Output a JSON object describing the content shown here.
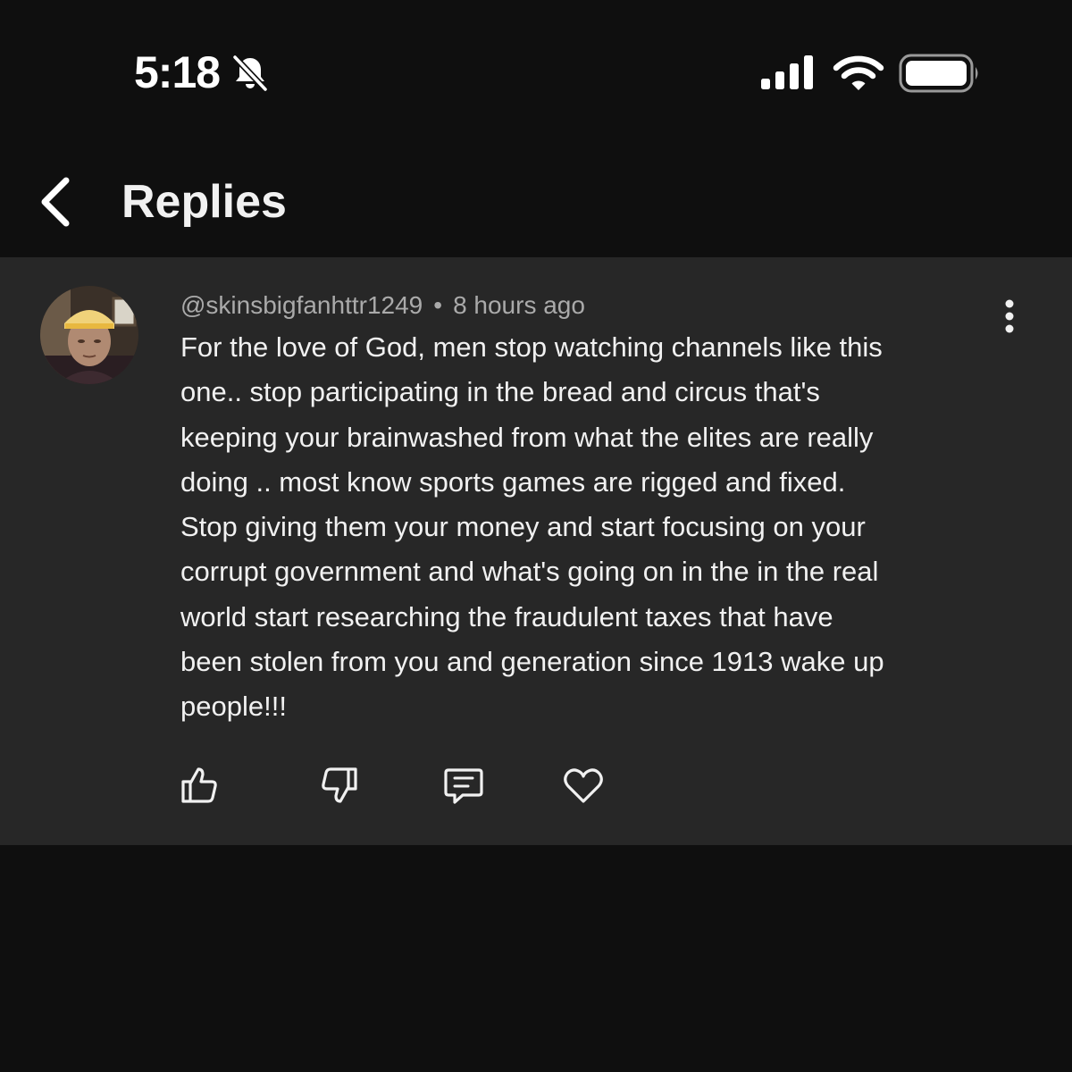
{
  "status_bar": {
    "time": "5:18",
    "bell_icon": "bell-slash-icon",
    "signal_icon": "cellular-signal-icon",
    "wifi_icon": "wifi-icon",
    "battery_icon": "battery-icon"
  },
  "header": {
    "back_icon": "chevron-left-icon",
    "title": "Replies"
  },
  "comment": {
    "username": "@skinsbigfanhttr1249",
    "separator": "•",
    "timestamp": "8 hours ago",
    "lines": [
      "For the love of God, men stop watching channels like this",
      "one.. stop participating in the bread and circus that's",
      "keeping your brainwashed from what the elites are really",
      "doing .. most know sports games are rigged and fixed.",
      "Stop giving them your money and start focusing on your",
      "corrupt government and what's going on in the in the real",
      "world start researching the fraudulent taxes that have",
      "been stolen from you and generation since 1913 wake up",
      "people!!!"
    ],
    "more_icon": "more-vertical-icon",
    "actions": [
      "thumbs-up-icon",
      "thumbs-down-icon",
      "reply-icon",
      "heart-icon"
    ]
  },
  "colors": {
    "background": "#0f0f0f",
    "card": "#272727",
    "text_primary": "#f1f1f1",
    "text_secondary": "#aaaaaa"
  }
}
